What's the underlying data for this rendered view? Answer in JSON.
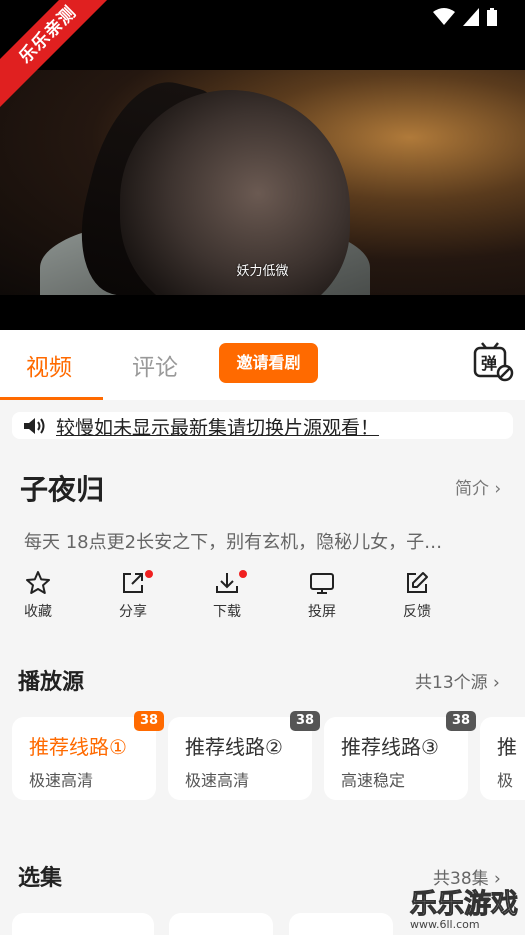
{
  "watermark_corner": "乐乐亲测",
  "video": {
    "subtitle": "妖力低微"
  },
  "tabs": {
    "video": "视频",
    "comment": "评论",
    "invite_button": "邀请看剧"
  },
  "notice": "较慢如未显示最新集请切换片源观看！",
  "show": {
    "title": "子夜归",
    "intro_link": "简介",
    "description": "每天 18点更2长安之下，别有玄机，隐秘儿女，子…"
  },
  "actions": [
    {
      "label": "收藏",
      "icon": "star-icon"
    },
    {
      "label": "分享",
      "icon": "share-icon"
    },
    {
      "label": "下载",
      "icon": "download-icon"
    },
    {
      "label": "投屏",
      "icon": "cast-screen-icon"
    },
    {
      "label": "反馈",
      "icon": "feedback-edit-icon"
    }
  ],
  "sources": {
    "title": "播放源",
    "more": "共13个源",
    "items": [
      {
        "name": "推荐线路①",
        "sub": "极速高清",
        "count": "38"
      },
      {
        "name": "推荐线路②",
        "sub": "极速高清",
        "count": "38"
      },
      {
        "name": "推荐线路③",
        "sub": "高速稳定",
        "count": "38"
      },
      {
        "name": "推",
        "sub": "极",
        "count": ""
      }
    ]
  },
  "episodes": {
    "title": "选集",
    "more": "共38集"
  },
  "site_watermark": {
    "text": "乐乐游戏",
    "url": "www.6ll.com"
  },
  "colors": {
    "accent": "#ff6a00",
    "badge_gray": "#555555",
    "dot_red": "#f02020"
  }
}
